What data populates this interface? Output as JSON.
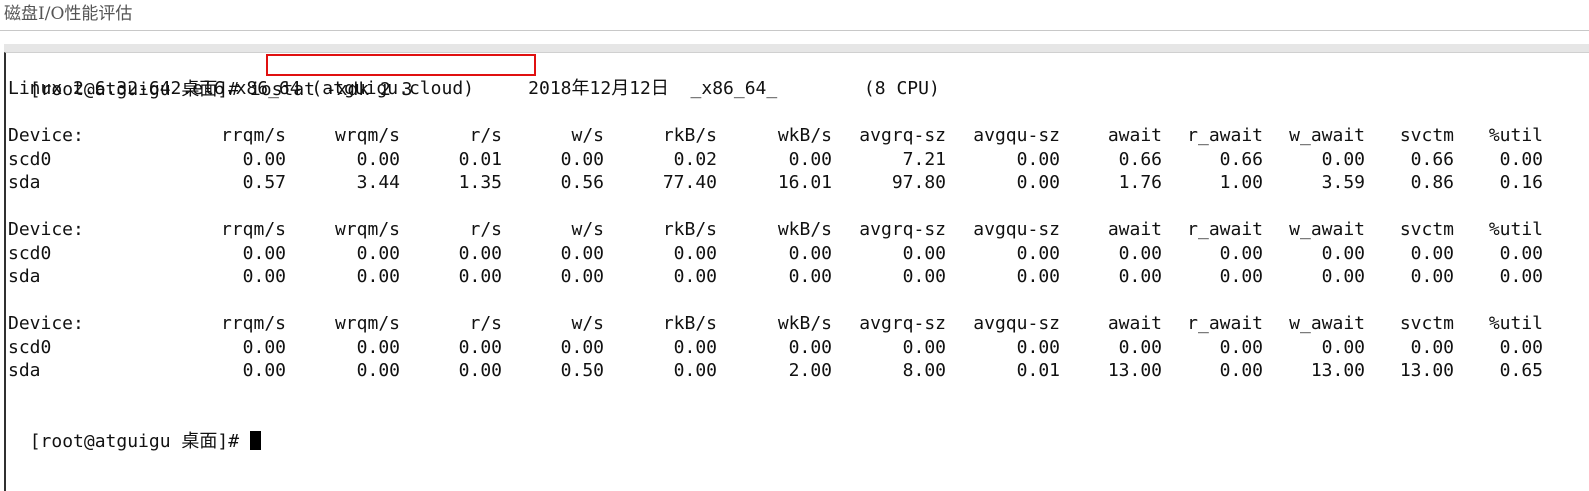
{
  "page": {
    "title": "磁盘I/O性能评估"
  },
  "terminal": {
    "prompt": "[root@atguigu 桌面]# ",
    "command": "iostat -xdk 2 3",
    "sysinfo": "Linux 2.6.32-642.el6.x86_64 (atguigu.cloud)     2018年12月12日  _x86_64_        (8 CPU)",
    "final_prompt": "[root@atguigu 桌面]# ",
    "columns": [
      "Device:",
      "rrqm/s",
      "wrqm/s",
      "r/s",
      "w/s",
      "rkB/s",
      "wkB/s",
      "avgrq-sz",
      "avgqu-sz",
      "await",
      "r_await",
      "w_await",
      "svctm",
      "%util"
    ],
    "reports": [
      {
        "rows": [
          [
            "scd0",
            "0.00",
            "0.00",
            "0.01",
            "0.00",
            "0.02",
            "0.00",
            "7.21",
            "0.00",
            "0.66",
            "0.66",
            "0.00",
            "0.66",
            "0.00"
          ],
          [
            "sda",
            "0.57",
            "3.44",
            "1.35",
            "0.56",
            "77.40",
            "16.01",
            "97.80",
            "0.00",
            "1.76",
            "1.00",
            "3.59",
            "0.86",
            "0.16"
          ]
        ]
      },
      {
        "rows": [
          [
            "scd0",
            "0.00",
            "0.00",
            "0.00",
            "0.00",
            "0.00",
            "0.00",
            "0.00",
            "0.00",
            "0.00",
            "0.00",
            "0.00",
            "0.00",
            "0.00"
          ],
          [
            "sda",
            "0.00",
            "0.00",
            "0.00",
            "0.00",
            "0.00",
            "0.00",
            "0.00",
            "0.00",
            "0.00",
            "0.00",
            "0.00",
            "0.00",
            "0.00"
          ]
        ]
      },
      {
        "rows": [
          [
            "scd0",
            "0.00",
            "0.00",
            "0.00",
            "0.00",
            "0.00",
            "0.00",
            "0.00",
            "0.00",
            "0.00",
            "0.00",
            "0.00",
            "0.00",
            "0.00"
          ],
          [
            "sda",
            "0.00",
            "0.00",
            "0.00",
            "0.50",
            "0.00",
            "2.00",
            "8.00",
            "0.01",
            "13.00",
            "0.00",
            "13.00",
            "13.00",
            "0.65"
          ]
        ]
      }
    ]
  },
  "colors": {
    "highlight": "#e01010",
    "text": "#111111",
    "background": "#ffffff"
  }
}
